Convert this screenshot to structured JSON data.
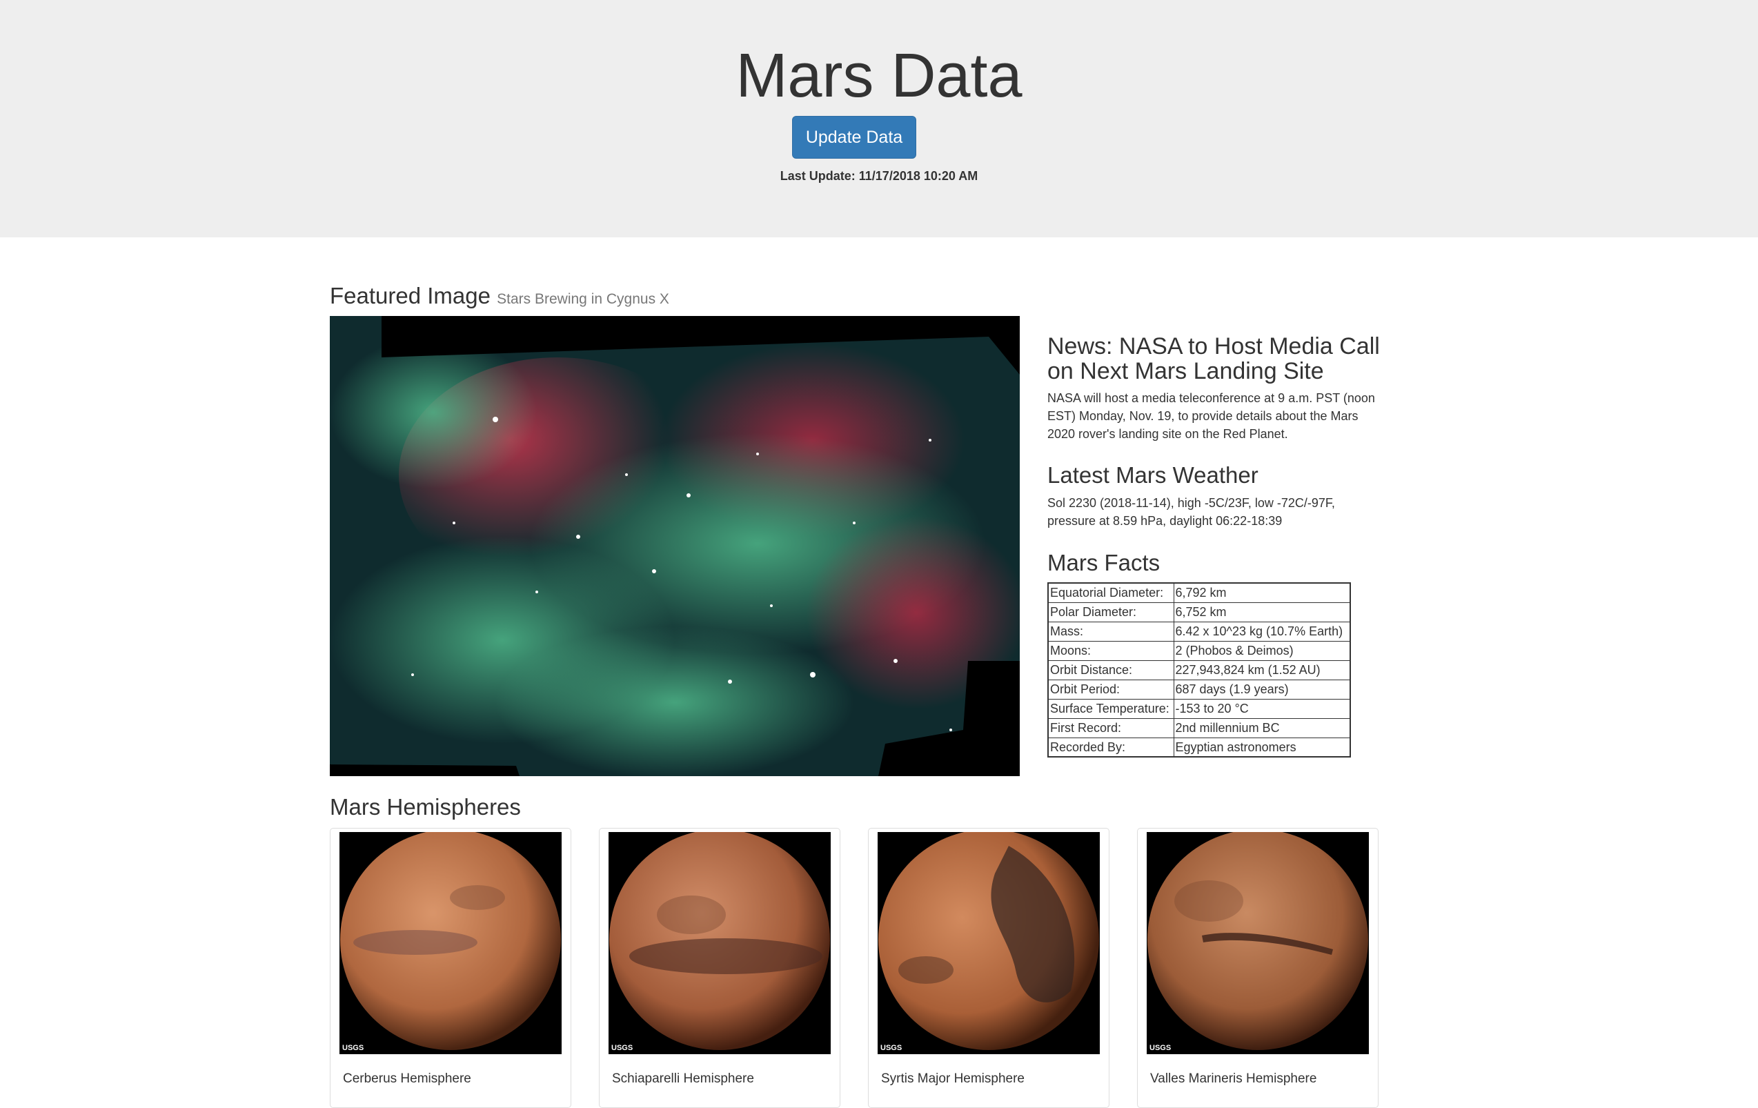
{
  "header": {
    "title": "Mars Data",
    "update_button_label": "Update Data",
    "last_update": "Last Update: 11/17/2018 10:20 AM"
  },
  "featured": {
    "heading": "Featured Image",
    "subtitle": "Stars Brewing in Cygnus X"
  },
  "news": {
    "title": "News: NASA to Host Media Call on Next Mars Landing Site",
    "body": "NASA will host a media teleconference at 9 a.m. PST (noon EST) Monday, Nov. 19, to provide details about the Mars 2020 rover's landing site on the Red Planet."
  },
  "weather": {
    "title": "Latest Mars Weather",
    "body": "Sol 2230 (2018-11-14), high -5C/23F, low -72C/-97F, pressure at 8.59 hPa, daylight 06:22-18:39"
  },
  "facts": {
    "title": "Mars Facts",
    "rows": [
      {
        "key": "Equatorial Diameter:",
        "value": "6,792 km"
      },
      {
        "key": "Polar Diameter:",
        "value": "6,752 km"
      },
      {
        "key": "Mass:",
        "value": "6.42 x 10^23 kg (10.7% Earth)"
      },
      {
        "key": "Moons:",
        "value": "2 (Phobos & Deimos)"
      },
      {
        "key": "Orbit Distance:",
        "value": "227,943,824 km (1.52 AU)"
      },
      {
        "key": "Orbit Period:",
        "value": "687 days (1.9 years)"
      },
      {
        "key": "Surface Temperature:",
        "value": "-153 to 20 °C"
      },
      {
        "key": "First Record:",
        "value": "2nd millennium BC"
      },
      {
        "key": "Recorded By:",
        "value": "Egyptian astronomers"
      }
    ]
  },
  "hemispheres": {
    "heading": "Mars Hemispheres",
    "usgs_label": "USGS",
    "items": [
      {
        "title": "Cerberus Hemisphere"
      },
      {
        "title": "Schiaparelli Hemisphere"
      },
      {
        "title": "Syrtis Major Hemisphere"
      },
      {
        "title": "Valles Marineris Hemisphere"
      }
    ]
  },
  "colors": {
    "jumbotron_bg": "#eeeeee",
    "button_bg": "#337ab7",
    "text": "#333333"
  }
}
